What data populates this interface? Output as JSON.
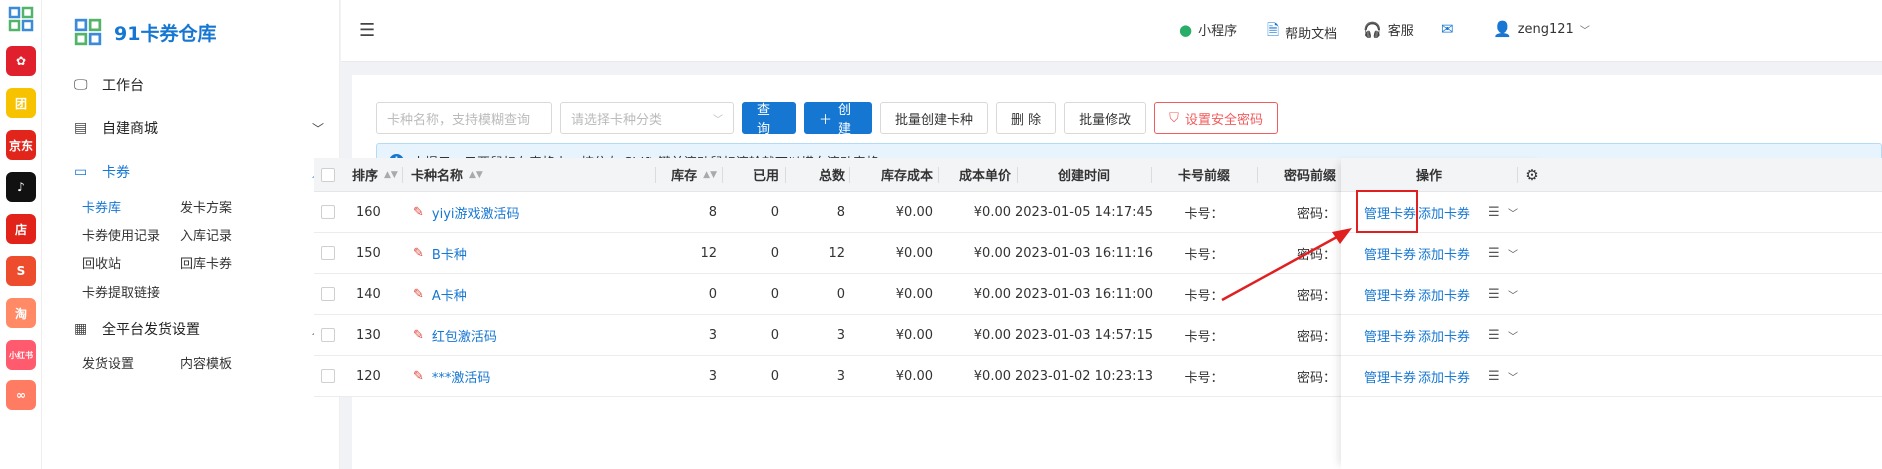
{
  "brand": {
    "title": "91卡券仓库"
  },
  "rail": [
    {
      "label": "✿",
      "color": "#e0202c"
    },
    {
      "label": "团",
      "color": "#f7c300"
    },
    {
      "label": "京东",
      "color": "#e1251b"
    },
    {
      "label": "♪",
      "color": "#111111"
    },
    {
      "label": "店",
      "color": "#e2231a"
    },
    {
      "label": "S",
      "color": "#ee4d2d"
    },
    {
      "label": "淘",
      "color": "#ff8a65"
    },
    {
      "label": "小红书",
      "color": "#ff5a6e"
    },
    {
      "label": "∞",
      "color": "#ff7b61"
    }
  ],
  "sidebar": {
    "workbench": "工作台",
    "mall": "自建商城",
    "cards": "卡券",
    "card_sub": [
      "卡券库",
      "发卡方案",
      "卡券使用记录",
      "入库记录",
      "回收站",
      "回库卡券",
      "卡券提取链接"
    ],
    "delivery": "全平台发货设置",
    "delivery_sub": [
      "发货设置",
      "内容模板"
    ]
  },
  "header": {
    "mini_program": "小程序",
    "help": "帮助文档",
    "service": "客服",
    "user": "zeng121"
  },
  "toolbar": {
    "search_placeholder": "卡种名称，支持模糊查询",
    "category_placeholder": "请选择卡种分类",
    "query": "查 询",
    "create": "创建",
    "batch_create": "批量创建卡种",
    "delete": "删 除",
    "batch_edit": "批量修改",
    "security": "设置安全密码"
  },
  "tip": "小提示：只要鼠标在表格上，按住左 Shift 键并滚动鼠标滚轮就可以横向滚动表格",
  "table": {
    "headers": {
      "sort": "排序",
      "name": "卡种名称",
      "stock": "库存",
      "used": "已用",
      "total": "总数",
      "stock_cost": "库存成本",
      "unit_cost": "成本单价",
      "created": "创建时间",
      "card_prefix": "卡号前缀",
      "pwd_prefix": "密码前缀",
      "ops": "操作"
    },
    "manage": "管理卡券",
    "add": "添加卡券",
    "rows": [
      {
        "sort": "160",
        "name": "yiyi游戏激活码",
        "stock": "8",
        "used": "0",
        "total": "8",
        "stock_cost": "¥0.00",
        "unit_cost": "¥0.00",
        "created": "2023-01-05 14:17:45",
        "card_prefix": "卡号：",
        "pwd_prefix": "密码："
      },
      {
        "sort": "150",
        "name": "B卡种",
        "stock": "12",
        "used": "0",
        "total": "12",
        "stock_cost": "¥0.00",
        "unit_cost": "¥0.00",
        "created": "2023-01-03 16:11:16",
        "card_prefix": "卡号：",
        "pwd_prefix": "密码："
      },
      {
        "sort": "140",
        "name": "A卡种",
        "stock": "0",
        "used": "0",
        "total": "0",
        "stock_cost": "¥0.00",
        "unit_cost": "¥0.00",
        "created": "2023-01-03 16:11:00",
        "card_prefix": "卡号：",
        "pwd_prefix": "密码："
      },
      {
        "sort": "130",
        "name": "红包激活码",
        "stock": "3",
        "used": "0",
        "total": "3",
        "stock_cost": "¥0.00",
        "unit_cost": "¥0.00",
        "created": "2023-01-03 14:57:15",
        "card_prefix": "卡号：",
        "pwd_prefix": "密码："
      },
      {
        "sort": "120",
        "name": "***激活码",
        "stock": "3",
        "used": "0",
        "total": "3",
        "stock_cost": "¥0.00",
        "unit_cost": "¥0.00",
        "created": "2023-01-02 10:23:13",
        "card_prefix": "卡号：",
        "pwd_prefix": "密码："
      }
    ]
  },
  "colors": {
    "primary": "#1677d2",
    "danger": "#f25c5c",
    "annotation": "#e02020"
  }
}
